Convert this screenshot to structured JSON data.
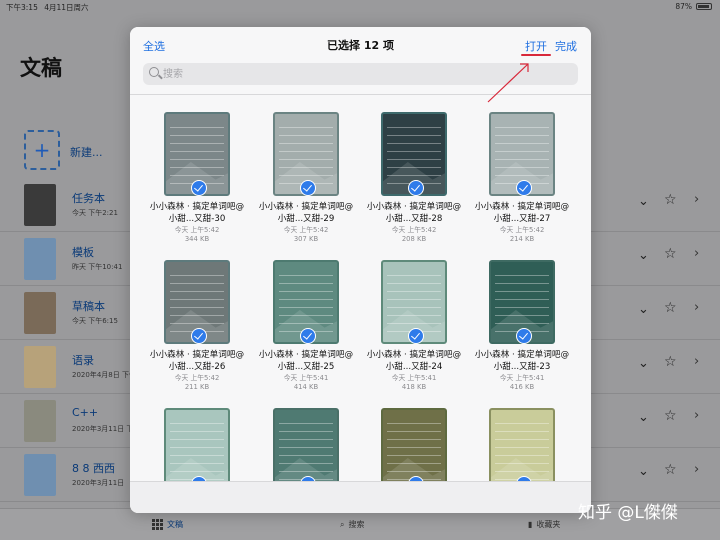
{
  "status_bar": {
    "time": "下午3:15",
    "date": "4月11日周六",
    "battery": "87%"
  },
  "background": {
    "title": "文稿",
    "new_label": "新建...",
    "rows": [
      {
        "name": "任务本",
        "date": "今天 下午2:21",
        "color": "#3a3a3a"
      },
      {
        "name": "模板",
        "date": "昨天 下午10:41",
        "color": "#6f8fb0"
      },
      {
        "name": "草稿本",
        "date": "今天 下午6:15",
        "color": "#7a6a58"
      },
      {
        "name": "语录",
        "date": "2020年4月8日 下午",
        "color": "#b7a27a"
      },
      {
        "name": "C++",
        "date": "2020年3月11日 下午",
        "color": "#8a8a7e"
      },
      {
        "name": "8 8 西西",
        "date": "2020年3月11日",
        "color": "#6f8fb0"
      }
    ],
    "tabs": {
      "files": "文稿",
      "search": "搜索",
      "favorites": "收藏夹"
    }
  },
  "modal": {
    "select_all": "全选",
    "title": "已选择 12 项",
    "open": "打开",
    "done": "完成",
    "search_placeholder": "搜索",
    "items": [
      {
        "name": "小小森林 · 搞定单词吧@小甜...又甜-30",
        "time": "今天 上午5:42",
        "size": "344 KB",
        "bg": "#7c8789",
        "border": "#5d7a7c"
      },
      {
        "name": "小小森林 · 搞定单词吧@小甜...又甜-29",
        "time": "今天 上午5:42",
        "size": "307 KB",
        "bg": "#a3adac",
        "border": "#6b8483"
      },
      {
        "name": "小小森林 · 搞定单词吧@小甜...又甜-28",
        "time": "今天 上午5:42",
        "size": "208 KB",
        "bg": "#2e4045",
        "border": "#3e6a6c"
      },
      {
        "name": "小小森林 · 搞定单词吧@小甜...又甜-27",
        "time": "今天 上午5:42",
        "size": "214 KB",
        "bg": "#a8b3b3",
        "border": "#6b8483"
      },
      {
        "name": "小小森林 · 搞定单词吧@小甜...又甜-26",
        "time": "今天 上午5:42",
        "size": "211 KB",
        "bg": "#6e7878",
        "border": "#5d7a7c"
      },
      {
        "name": "小小森林 · 搞定单词吧@小甜...又甜-25",
        "time": "今天 上午5:41",
        "size": "414 KB",
        "bg": "#5e8a80",
        "border": "#4d7a70"
      },
      {
        "name": "小小森林 · 搞定单词吧@小甜...又甜-24",
        "time": "今天 上午5:41",
        "size": "418 KB",
        "bg": "#a8c3bb",
        "border": "#5e8a7a"
      },
      {
        "name": "小小森林 · 搞定单词吧@小甜...又甜-23",
        "time": "今天 上午5:41",
        "size": "416 KB",
        "bg": "#2f5e56",
        "border": "#3e6a62"
      },
      {
        "name": "",
        "time": "",
        "size": "",
        "bg": "#a9c6be",
        "border": "#5e8a7a"
      },
      {
        "name": "",
        "time": "",
        "size": "",
        "bg": "#4f7a72",
        "border": "#4a7068"
      },
      {
        "name": "",
        "time": "",
        "size": "",
        "bg": "#6f7048",
        "border": "#5e6a40"
      },
      {
        "name": "",
        "time": "",
        "size": "",
        "bg": "#c9cc9a",
        "border": "#8a9060"
      }
    ]
  },
  "watermark": "知乎 @L傑傑",
  "accent": "#1f6fe0",
  "annotation_color": "#d8283a"
}
